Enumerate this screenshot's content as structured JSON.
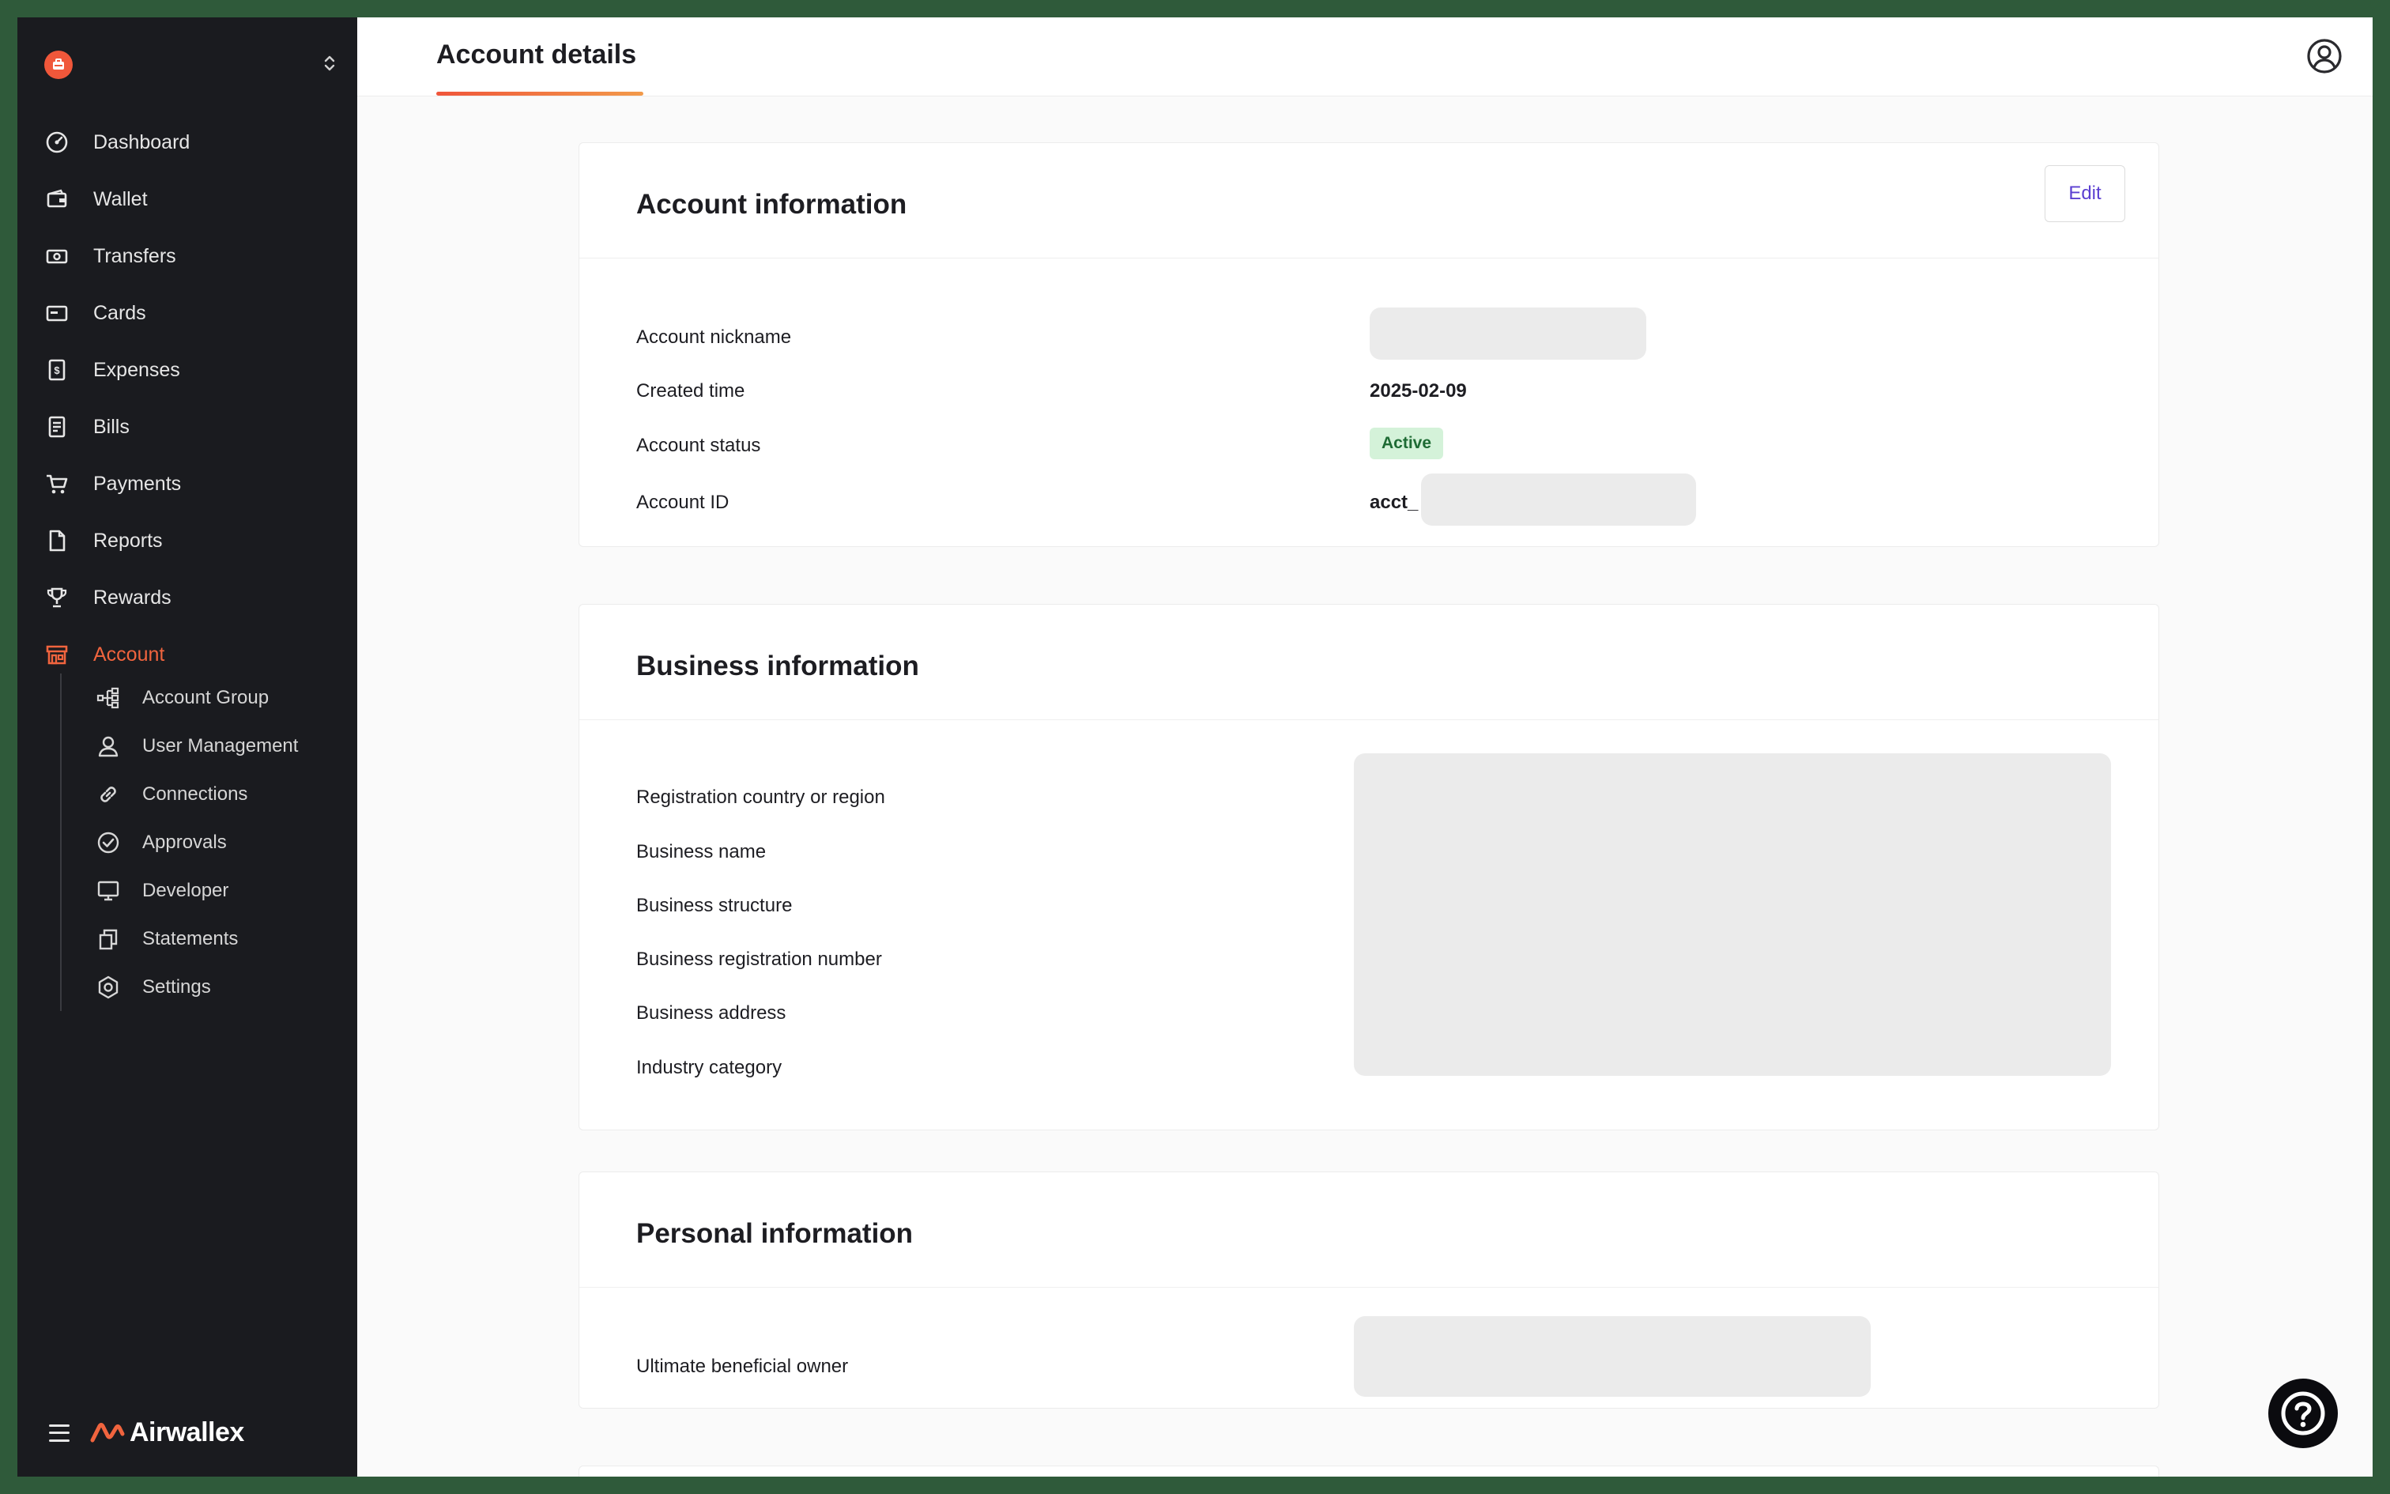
{
  "sidebar": {
    "nav": [
      {
        "label": "Dashboard",
        "icon": "dashboard-icon"
      },
      {
        "label": "Wallet",
        "icon": "wallet-icon"
      },
      {
        "label": "Transfers",
        "icon": "transfers-icon"
      },
      {
        "label": "Cards",
        "icon": "cards-icon"
      },
      {
        "label": "Expenses",
        "icon": "expenses-icon"
      },
      {
        "label": "Bills",
        "icon": "bills-icon"
      },
      {
        "label": "Payments",
        "icon": "cart-icon"
      },
      {
        "label": "Reports",
        "icon": "report-icon"
      },
      {
        "label": "Rewards",
        "icon": "trophy-icon"
      },
      {
        "label": "Account",
        "icon": "store-icon",
        "active": true
      }
    ],
    "subnav": [
      {
        "label": "Account Group",
        "icon": "hierarchy-icon"
      },
      {
        "label": "User Management",
        "icon": "user-icon"
      },
      {
        "label": "Connections",
        "icon": "link-icon"
      },
      {
        "label": "Approvals",
        "icon": "check-circle-icon"
      },
      {
        "label": "Developer",
        "icon": "monitor-icon"
      },
      {
        "label": "Statements",
        "icon": "copy-icon"
      },
      {
        "label": "Settings",
        "icon": "gear-icon"
      }
    ],
    "brand": "Airwallex"
  },
  "header": {
    "tab": "Account details"
  },
  "account_info": {
    "title": "Account information",
    "edit_label": "Edit",
    "nickname_label": "Account nickname",
    "created_label": "Created time",
    "created_value": "2025-02-09",
    "status_label": "Account status",
    "status_value": "Active",
    "id_label": "Account ID",
    "id_prefix": "acct_"
  },
  "business_info": {
    "title": "Business information",
    "fields": [
      "Registration country or region",
      "Business name",
      "Business structure",
      "Business registration number",
      "Business address",
      "Industry category"
    ]
  },
  "personal_info": {
    "title": "Personal information",
    "ubo_label": "Ultimate beneficial owner"
  },
  "colors": {
    "accent": "#f0643e",
    "sidebar_bg": "#1a1b1f",
    "link": "#5b3fd1",
    "active_badge_bg": "#d4f2d9"
  }
}
